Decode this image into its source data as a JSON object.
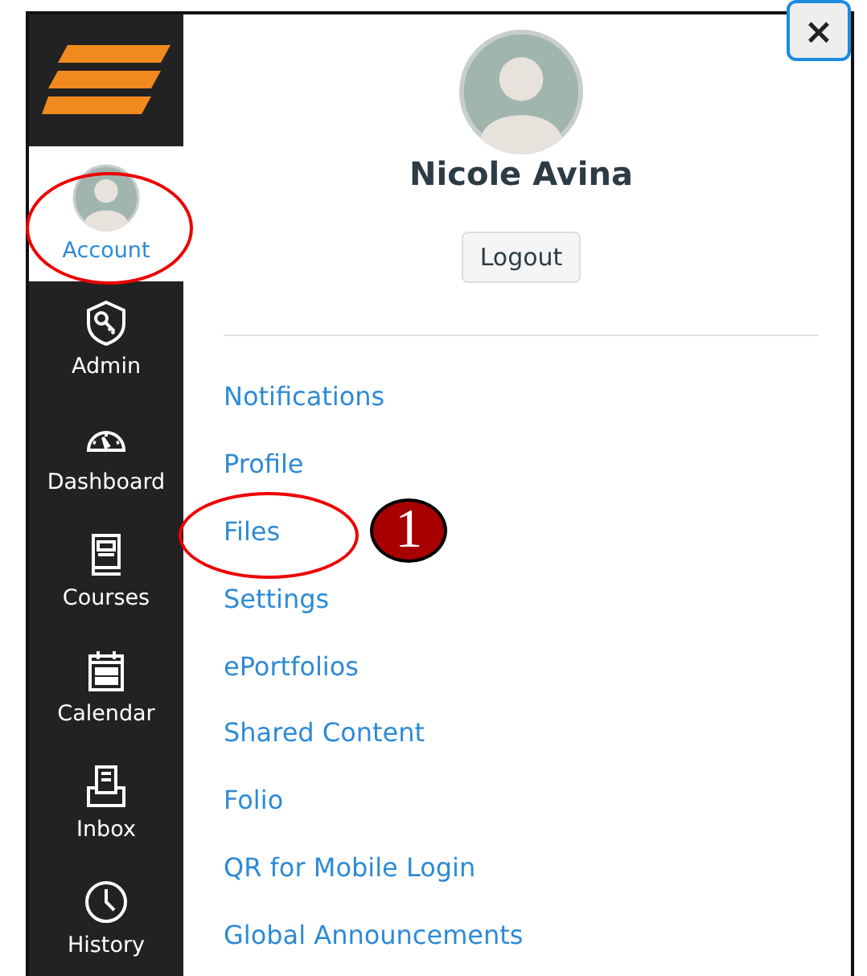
{
  "sidebar": {
    "items": [
      {
        "label": "Account",
        "selected": true,
        "circled": true
      },
      {
        "label": "Admin",
        "selected": false
      },
      {
        "label": "Dashboard",
        "selected": false
      },
      {
        "label": "Courses",
        "selected": false
      },
      {
        "label": "Calendar",
        "selected": false
      },
      {
        "label": "Inbox",
        "selected": false
      },
      {
        "label": "History",
        "selected": false
      }
    ]
  },
  "close_button": {
    "label": "×"
  },
  "profile": {
    "name": "Nicole Avina",
    "logout": "Logout"
  },
  "links": [
    {
      "label": "Notifications"
    },
    {
      "label": "Profile"
    },
    {
      "label": "Files",
      "circled": true,
      "callout": "1"
    },
    {
      "label": "Settings"
    },
    {
      "label": "ePortfolios"
    },
    {
      "label": "Shared Content"
    },
    {
      "label": "Folio"
    },
    {
      "label": "QR for Mobile Login"
    },
    {
      "label": "Global Announcements"
    }
  ]
}
